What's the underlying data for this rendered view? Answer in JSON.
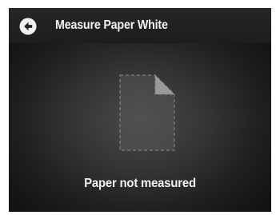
{
  "header": {
    "title": "Measure Paper White",
    "back_icon": "back-arrow-circle-icon"
  },
  "main": {
    "document_icon": "blank-document-icon",
    "status_text": "Paper not measured"
  },
  "colors": {
    "text": "#f2f2f2",
    "background_center": "#4a4a4a",
    "background_edge": "#141414",
    "header": "#222222",
    "icon_fill": "#505050",
    "icon_stroke": "#8a8a8a"
  }
}
